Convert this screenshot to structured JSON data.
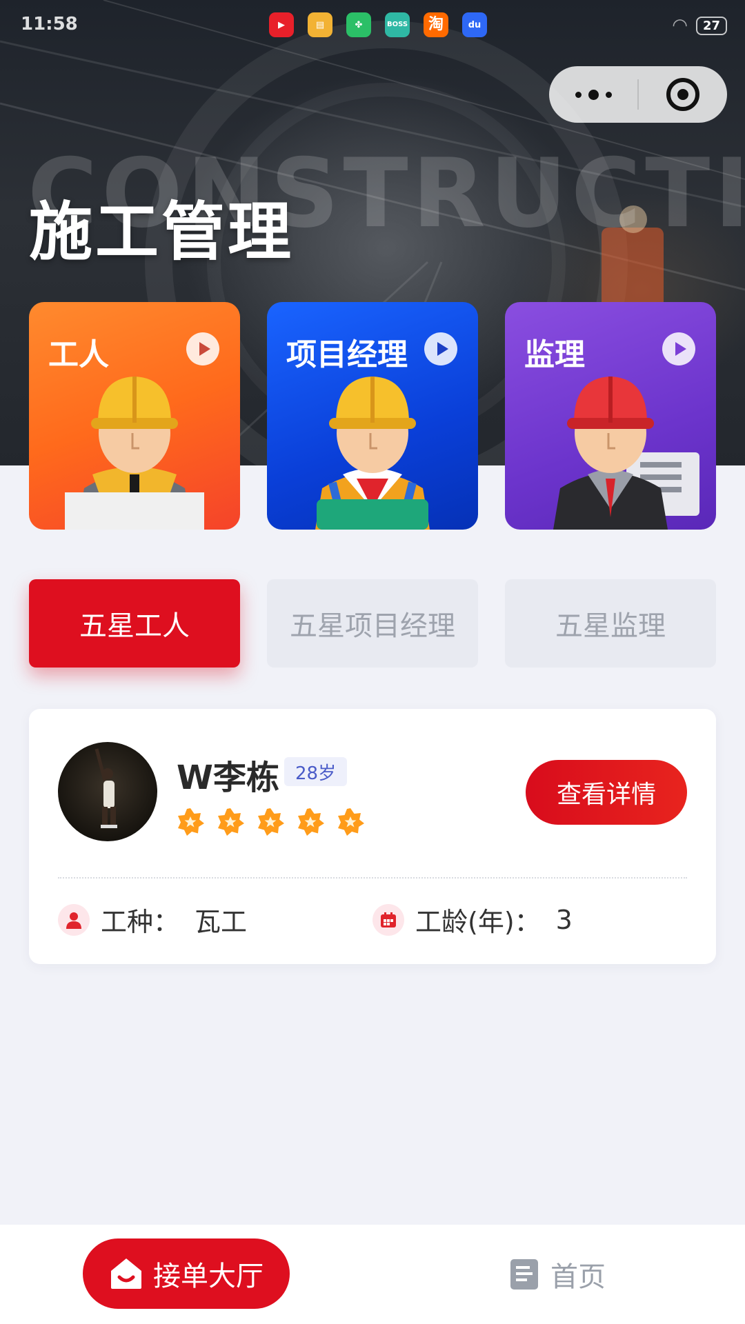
{
  "status_bar": {
    "time": "11:58",
    "apps": [
      {
        "name": "video-app-icon",
        "color": "#e8202a",
        "text": "▶"
      },
      {
        "name": "files-app-icon",
        "color": "#f2b234",
        "text": "▤"
      },
      {
        "name": "clover-app-icon",
        "color": "#2bbf67",
        "text": "✤"
      },
      {
        "name": "boss-app-icon",
        "color": "#2fb8a4",
        "text": "BOSS"
      },
      {
        "name": "taobao-app-icon",
        "color": "#ff6a00",
        "text": "淘"
      },
      {
        "name": "baidu-app-icon",
        "color": "#2e68f5",
        "text": "du"
      }
    ],
    "battery": "27"
  },
  "hero": {
    "watermark": "CONSTRUCTION",
    "title": "施工管理"
  },
  "roles": [
    {
      "label": "工人"
    },
    {
      "label": "项目经理"
    },
    {
      "label": "监理"
    }
  ],
  "tabs": {
    "active": "五星工人",
    "pm": "五星项目经理",
    "supervisor": "五星监理"
  },
  "worker": {
    "name": "W李栋",
    "age": "28岁",
    "rating": 5,
    "detail_button": "查看详情",
    "trade_label": "工种：",
    "trade_value": "瓦工",
    "years_label": "工龄(年)：",
    "years_value": "3"
  },
  "bottom_nav": {
    "hall": "接单大厅",
    "home": "首页"
  },
  "colors": {
    "primary_red": "#de0f1f",
    "worker_card": "#ff6a1c",
    "pm_card": "#0a3fd8",
    "supervisor_card": "#6c34cc",
    "star": "#ff9c1a"
  }
}
